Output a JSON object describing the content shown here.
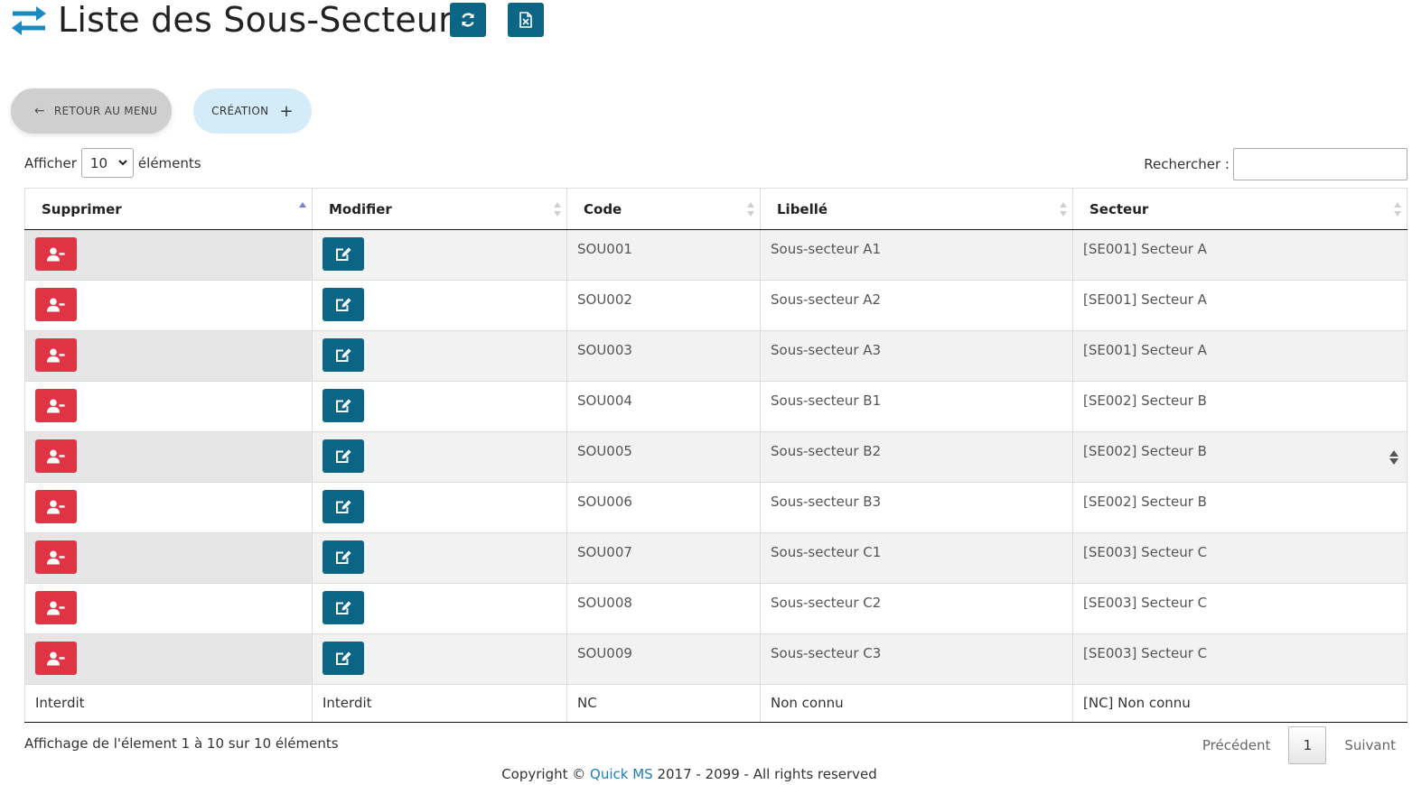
{
  "header": {
    "title": "Liste des Sous-Secteurs",
    "icons": [
      "swap-arrows-icon",
      "refresh-icon",
      "excel-export-icon"
    ]
  },
  "actions": {
    "back_label": "Retour au menu",
    "back_icon": "arrow-left-icon",
    "create_label": "Création",
    "create_icon": "plus-icon"
  },
  "table_controls": {
    "show_label": "Afficher",
    "page_length": "10",
    "entries_label": "éléments",
    "search_label": "Rechercher :"
  },
  "table": {
    "headers": [
      "Supprimer",
      "Modifier",
      "Code",
      "Libellé",
      "Secteur"
    ],
    "sorted_column": "Supprimer",
    "rows": [
      {
        "code": "SOU001",
        "libelle": "Sous-secteur A1",
        "secteur": "[SE001] Secteur A"
      },
      {
        "code": "SOU002",
        "libelle": "Sous-secteur A2",
        "secteur": "[SE001] Secteur A"
      },
      {
        "code": "SOU003",
        "libelle": "Sous-secteur A3",
        "secteur": "[SE001] Secteur A"
      },
      {
        "code": "SOU004",
        "libelle": "Sous-secteur B1",
        "secteur": "[SE002] Secteur B"
      },
      {
        "code": "SOU005",
        "libelle": "Sous-secteur B2",
        "secteur": "[SE002] Secteur B"
      },
      {
        "code": "SOU006",
        "libelle": "Sous-secteur B3",
        "secteur": "[SE002] Secteur B"
      },
      {
        "code": "SOU007",
        "libelle": "Sous-secteur C1",
        "secteur": "[SE003] Secteur C"
      },
      {
        "code": "SOU008",
        "libelle": "Sous-secteur C2",
        "secteur": "[SE003] Secteur C"
      },
      {
        "code": "SOU009",
        "libelle": "Sous-secteur C3",
        "secteur": "[SE003] Secteur C"
      }
    ],
    "last_row": {
      "supprimer": "Interdit",
      "modifier": "Interdit",
      "code": "NC",
      "libelle": "Non connu",
      "secteur": "[NC] Non connu"
    }
  },
  "pagination": {
    "info": "Affichage de l'élement 1 à 10 sur 10 éléments",
    "previous": "Précédent",
    "current_page": "1",
    "next": "Suivant"
  },
  "footer": {
    "prefix": "Copyright ©",
    "link": "Quick MS",
    "suffix": "2017 - 2099 - All rights reserved"
  },
  "colors": {
    "primary": "#0b6585",
    "danger": "#e03444",
    "back_button": "#cfcfcf",
    "create_button": "#d4ecf8",
    "link": "#1d7db4"
  }
}
